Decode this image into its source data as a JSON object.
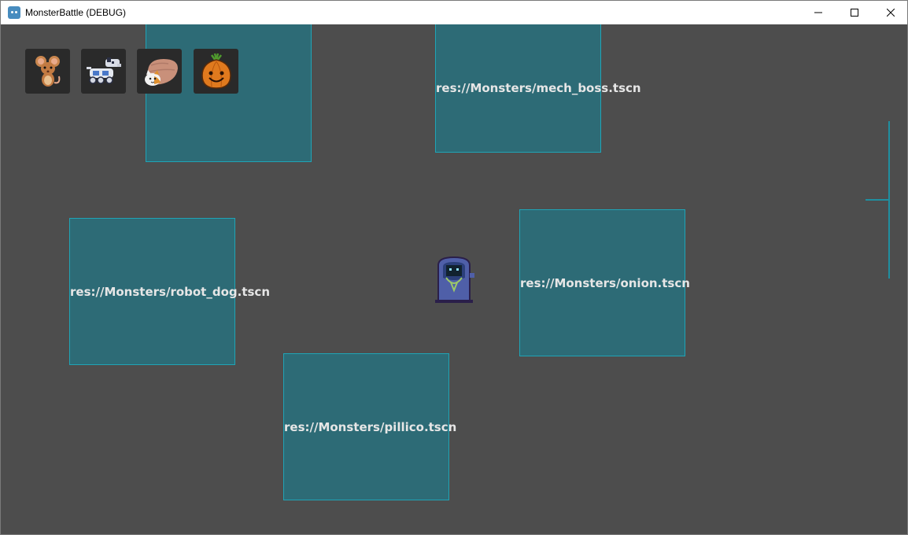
{
  "window": {
    "title": "MonsterBattle (DEBUG)"
  },
  "hud": {
    "slots": [
      {
        "icon": "mouse-icon"
      },
      {
        "icon": "robot-dog-icon"
      },
      {
        "icon": "cat-in-sack-icon"
      },
      {
        "icon": "onion-icon"
      }
    ]
  },
  "areas": [
    {
      "label": ""
    },
    {
      "label": "res://Monsters/mech_boss.tscn"
    },
    {
      "label": "res://Monsters/robot_dog.tscn"
    },
    {
      "label": "res://Monsters/onion.tscn"
    },
    {
      "label": "res://Monsters/pillico.tscn"
    }
  ],
  "colors": {
    "background": "#4d4d4d",
    "area_fill": "#2d6b76",
    "area_border": "#1fa4b6",
    "hud_slot": "#2a2a2a"
  }
}
